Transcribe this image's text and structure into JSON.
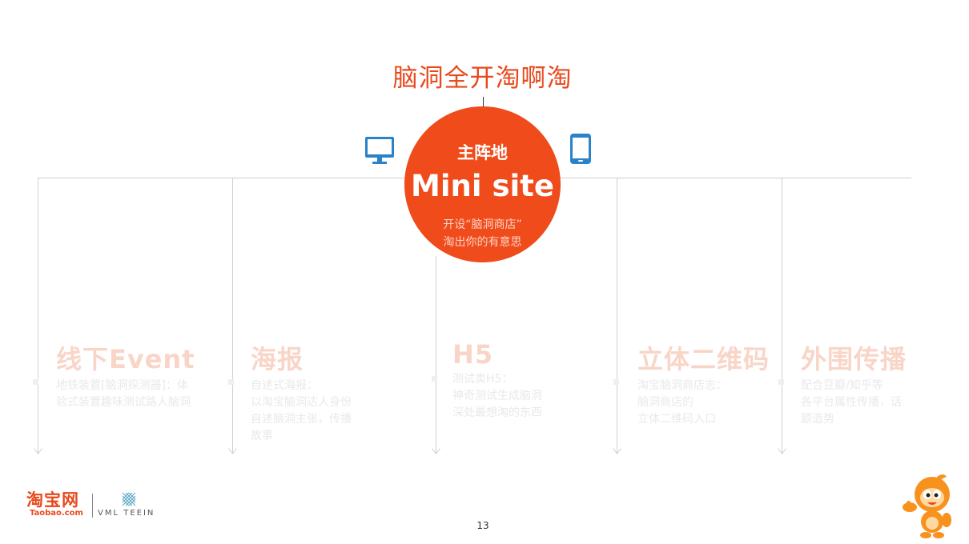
{
  "slide": {
    "title": "脑洞全开淘啊淘",
    "page_number": "13"
  },
  "center": {
    "label": "主阵地",
    "title": "Mini site",
    "subtitle_line1": "开设“脑洞商店”",
    "subtitle_line2": "淘出你的有意思",
    "color": "#ef4b1b"
  },
  "icons": {
    "left": "desktop-monitor-icon",
    "right": "smartphone-icon",
    "color": "#2a83c9"
  },
  "columns": [
    {
      "title": "线下Event",
      "desc": [
        "地铁装置[脑洞探测器]：体",
        "验式装置趣味测试路人脑洞"
      ]
    },
    {
      "title": "海报",
      "desc": [
        "自述式海报：",
        "以淘宝脑洞达人身份",
        "自述脑洞主张，传播",
        "故事"
      ]
    },
    {
      "title": "H5",
      "desc": [
        "测试类H5：",
        "神奇测试生成脑洞",
        "深处最想淘的东西"
      ]
    },
    {
      "title": "立体二维码",
      "desc": [
        "淘宝脑洞商店志：",
        "脑洞商店的",
        "立体二维码入口"
      ]
    },
    {
      "title": "外围传播",
      "desc": [
        "配合豆瓣/知乎等",
        "各平台属性传播，话",
        "题造势"
      ]
    }
  ],
  "logos": {
    "taobao_cn": "淘宝网",
    "taobao_en": "Taobao.com",
    "agency": "VML TEEIN"
  },
  "colors": {
    "accent": "#e8491d",
    "faded_title": "#f9d5c8",
    "faded_text": "#e9e9e9",
    "line": "#cfcfcf"
  }
}
